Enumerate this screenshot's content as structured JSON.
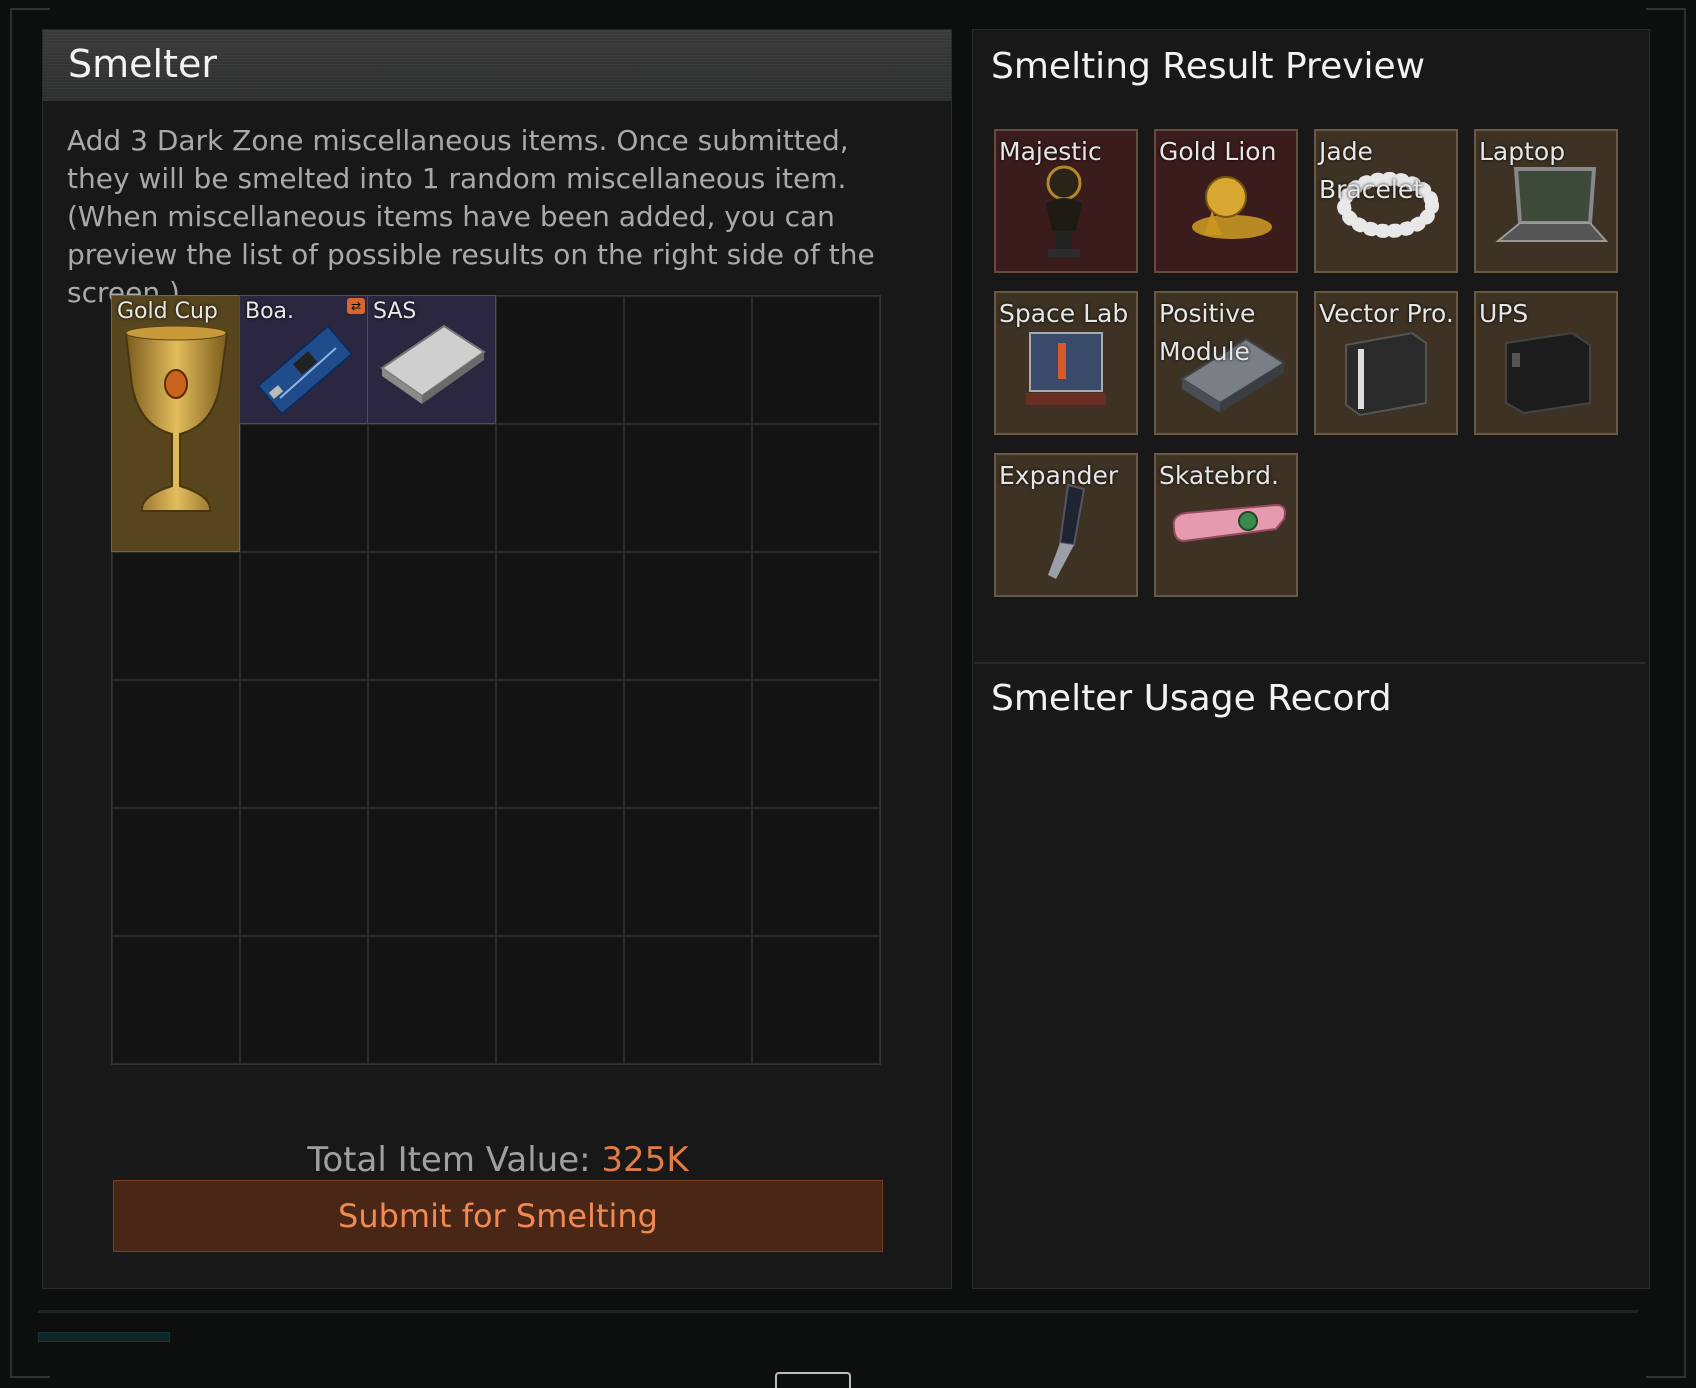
{
  "smelter": {
    "title": "Smelter",
    "description": "Add 3 Dark Zone miscellaneous items. Once submitted, they will be smelted into 1 random miscellaneous item. (When miscellaneous items have been added, you can preview the list of possible results on the right side of the screen.)",
    "items": [
      {
        "label": "Gold Cup",
        "icon": "gold-cup-icon"
      },
      {
        "label": "Boa.",
        "icon": "circuit-board-icon"
      },
      {
        "label": "SAS",
        "icon": "hard-drive-icon"
      }
    ],
    "total_label": "Total Item Value:",
    "total_value": "325K",
    "submit_label": "Submit for Smelting"
  },
  "preview": {
    "title": "Smelting Result Preview",
    "items": [
      {
        "label": "Majestic",
        "icon": "bust-statue-icon"
      },
      {
        "label": "Gold Lion",
        "icon": "gold-lion-icon"
      },
      {
        "label": "Jade Bracelet",
        "icon": "bracelet-icon"
      },
      {
        "label": "Laptop",
        "icon": "laptop-icon"
      },
      {
        "label": "Space Lab",
        "icon": "space-lab-kit-icon"
      },
      {
        "label": "Positive Module",
        "icon": "module-icon"
      },
      {
        "label": "Vector Pro.",
        "icon": "vector-processor-icon"
      },
      {
        "label": "UPS",
        "icon": "ups-icon"
      },
      {
        "label": "Expander",
        "icon": "expander-icon"
      },
      {
        "label": "Skatebrd.",
        "icon": "hoverboard-icon"
      }
    ]
  },
  "usage": {
    "title": "Smelter Usage Record"
  },
  "colors": {
    "accent": "#e07a47",
    "rare_tile": "#3b1c1c",
    "common_tile": "#3d3224"
  }
}
